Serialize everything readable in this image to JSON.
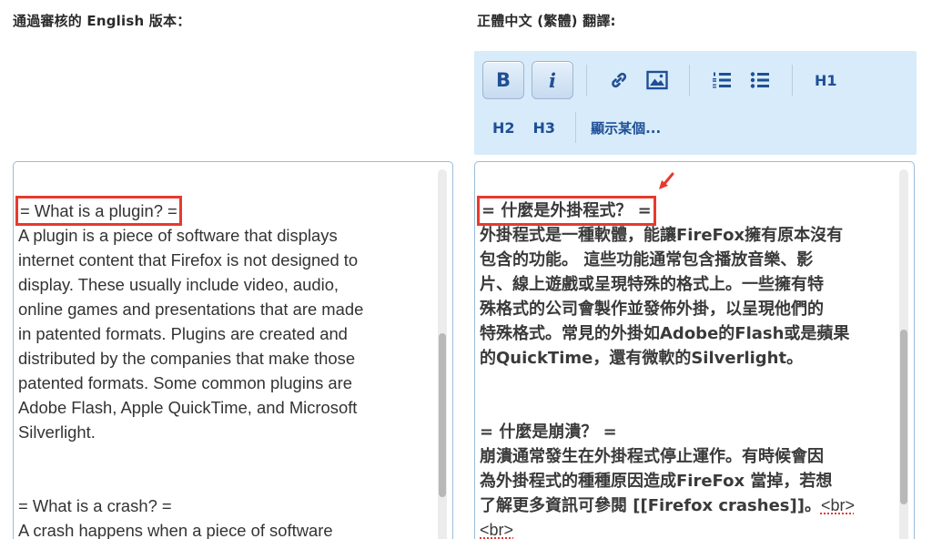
{
  "labels": {
    "left": "通過審核的 English 版本：",
    "right": "正體中文 (繁體) 翻譯:"
  },
  "toolbar": {
    "bold": "B",
    "italic": "i",
    "h1": "H1",
    "h2": "H2",
    "h3": "H3",
    "show_some": "顯示某個..."
  },
  "icons": {
    "link": "link-icon",
    "image": "image-icon",
    "ordered_list": "ordered-list-icon",
    "bullet_list": "bullet-list-icon"
  },
  "colors": {
    "toolbar_bg": "#d7ebfa",
    "toolbar_text": "#1f4f95",
    "highlight": "#e8392d"
  },
  "english": {
    "heading1": "= What is a plugin? =",
    "para1": [
      "A plugin is a piece of software that displays",
      "internet content that Firefox is not designed to",
      "display. These usually include video, audio,",
      "online games and presentations that are made",
      "in patented formats. Plugins are created and",
      "distributed by the companies that make those",
      "patented formats. Some common plugins are",
      "Adobe Flash, Apple QuickTime, and Microsoft",
      "Silverlight."
    ],
    "heading2": "= What is a crash? =",
    "para2": [
      "A crash happens when a piece of software"
    ]
  },
  "chinese": {
    "heading1": "= 什麼是外掛程式？ =",
    "para1": [
      "外掛程式是一種軟體，能讓FireFox擁有原本沒有",
      "包含的功能。 這些功能通常包含播放音樂、影",
      "片、線上遊戲或呈現特殊的格式上。一些擁有特",
      "殊格式的公司會製作並發佈外掛，以呈現他們的",
      "特殊格式。常見的外掛如Adobe的Flash或是蘋果",
      "的QuickTime，還有微軟的Silverlight。"
    ],
    "heading2": "= 什麼是崩潰？ =",
    "para2": [
      "崩潰通常發生在外掛程式停止運作。有時候會因",
      "為外掛程式的種種原因造成FireFox 當掉，若想",
      "了解更多資訊可參閱 [[Firefox crashes]]。"
    ],
    "br1": "<br>",
    "br2": "<br>"
  }
}
